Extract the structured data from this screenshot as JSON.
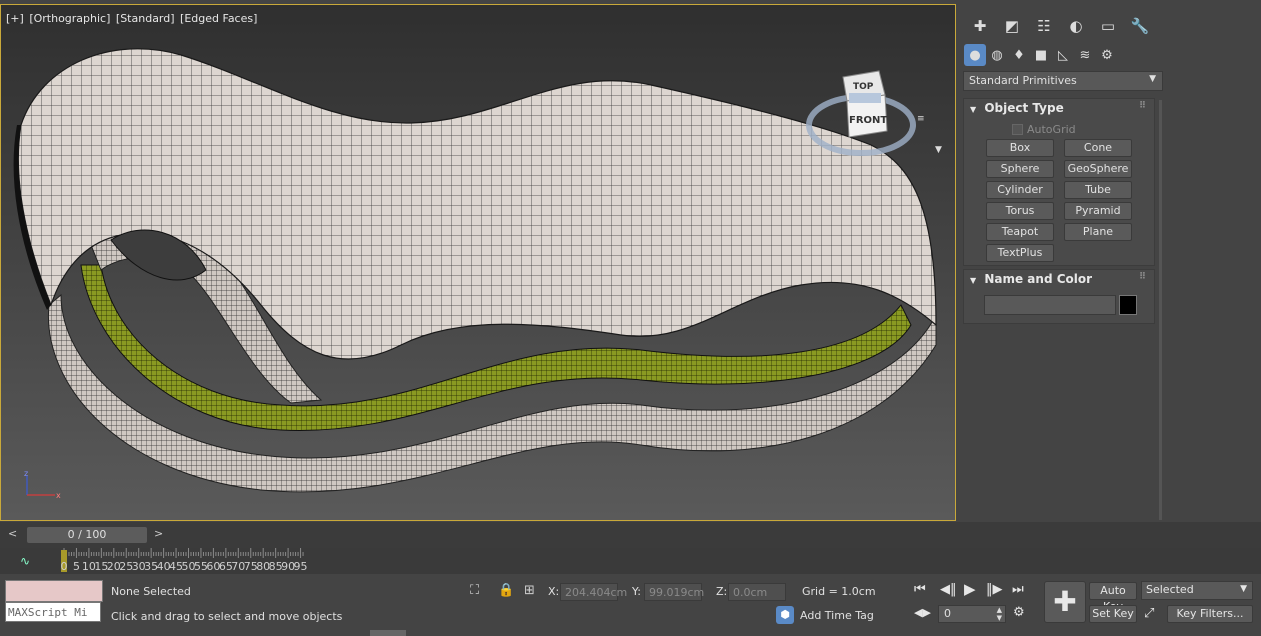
{
  "viewport": {
    "label_plus": "[+]",
    "label_view": "[Orthographic]",
    "label_shading": "[Standard]",
    "label_edges": "[Edged Faces]",
    "viewcube_top": "TOP",
    "viewcube_front": "FRONT",
    "axis_z": "z",
    "axis_x": "x",
    "accent_color": "#c9a93a"
  },
  "command_panel": {
    "tabs": [
      "create-icon",
      "modify-icon",
      "hierarchy-icon",
      "motion-icon",
      "display-icon",
      "utilities-icon"
    ],
    "subtabs": [
      "geometry-icon",
      "shapes-icon",
      "lights-icon",
      "cameras-icon",
      "helpers-icon",
      "spacewarps-icon",
      "systems-icon"
    ],
    "category_dropdown": "Standard Primitives",
    "object_type": {
      "title": "Object Type",
      "autogrid": "AutoGrid",
      "buttons": [
        "Box",
        "Cone",
        "Sphere",
        "GeoSphere",
        "Cylinder",
        "Tube",
        "Torus",
        "Pyramid",
        "Teapot",
        "Plane",
        "TextPlus"
      ]
    },
    "name_and_color": {
      "title": "Name and Color",
      "name_value": "",
      "color": "#000000"
    }
  },
  "time_slider": {
    "prev": "<",
    "position": "0 / 100",
    "next": ">"
  },
  "trackbar": {
    "ticks": [
      "0",
      "5",
      "10",
      "15",
      "20",
      "25",
      "30",
      "35",
      "40",
      "45",
      "50",
      "55",
      "60",
      "65",
      "70",
      "75",
      "80",
      "85",
      "90",
      "95"
    ]
  },
  "status_bar": {
    "selection": "None Selected",
    "prompt": "Click and drag to select and move objects",
    "maxscript_placeholder": "MAXScript Mi",
    "x_label": "X:",
    "x_value": "204.404cm",
    "y_label": "Y:",
    "y_value": "99.019cm",
    "z_label": "Z:",
    "z_value": "0.0cm",
    "grid": "Grid = 1.0cm",
    "add_time_tag": "Add Time Tag",
    "frame_value": "0",
    "auto_key": "Auto Key",
    "set_key": "Set Key",
    "selected_dropdown": "Selected",
    "key_filters": "Key Filters..."
  }
}
